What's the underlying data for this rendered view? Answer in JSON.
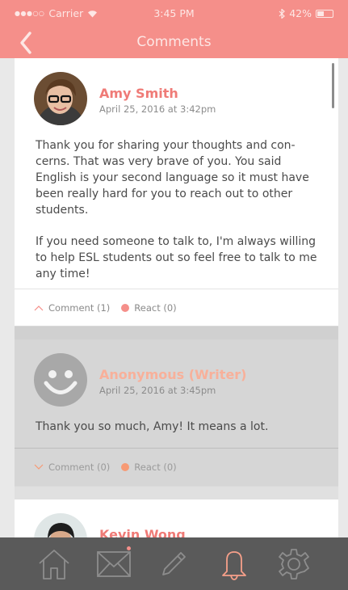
{
  "status_bar": {
    "carrier": "Carrier",
    "time": "3:45 PM",
    "battery": "42%"
  },
  "nav": {
    "title": "Comments",
    "back_icon": "chevron-left-icon"
  },
  "comments": [
    {
      "author": "Amy Smith",
      "date": "April 25, 2016 at 3:42pm",
      "paragraphs": [
        "Thank you for sharing your thoughts and con-cerns. That was very brave of you. You said English is your second language so it must have been really hard for you to reach out to other students.",
        "If you need someone to talk to, I'm always willing to help ESL students out so feel free to talk to me any time!"
      ],
      "comment_label": "Comment (1)",
      "react_label": "React (0)"
    },
    {
      "author": "Anonymous (Writer)",
      "date": "April 25, 2016 at 3:45pm",
      "paragraphs": [
        "Thank you so much, Amy! It means a lot."
      ],
      "comment_label": "Comment (0)",
      "react_label": "React (0)"
    },
    {
      "author": "Kevin Wong"
    }
  ],
  "tabbar": {
    "tabs": [
      "home-icon",
      "mail-icon",
      "pencil-icon",
      "bell-icon",
      "gear-icon"
    ],
    "active": "bell-icon"
  },
  "colors": {
    "accent": "#f58f8a",
    "tabbar": "#5a5a5a",
    "active_tab": "#f7a08a"
  }
}
